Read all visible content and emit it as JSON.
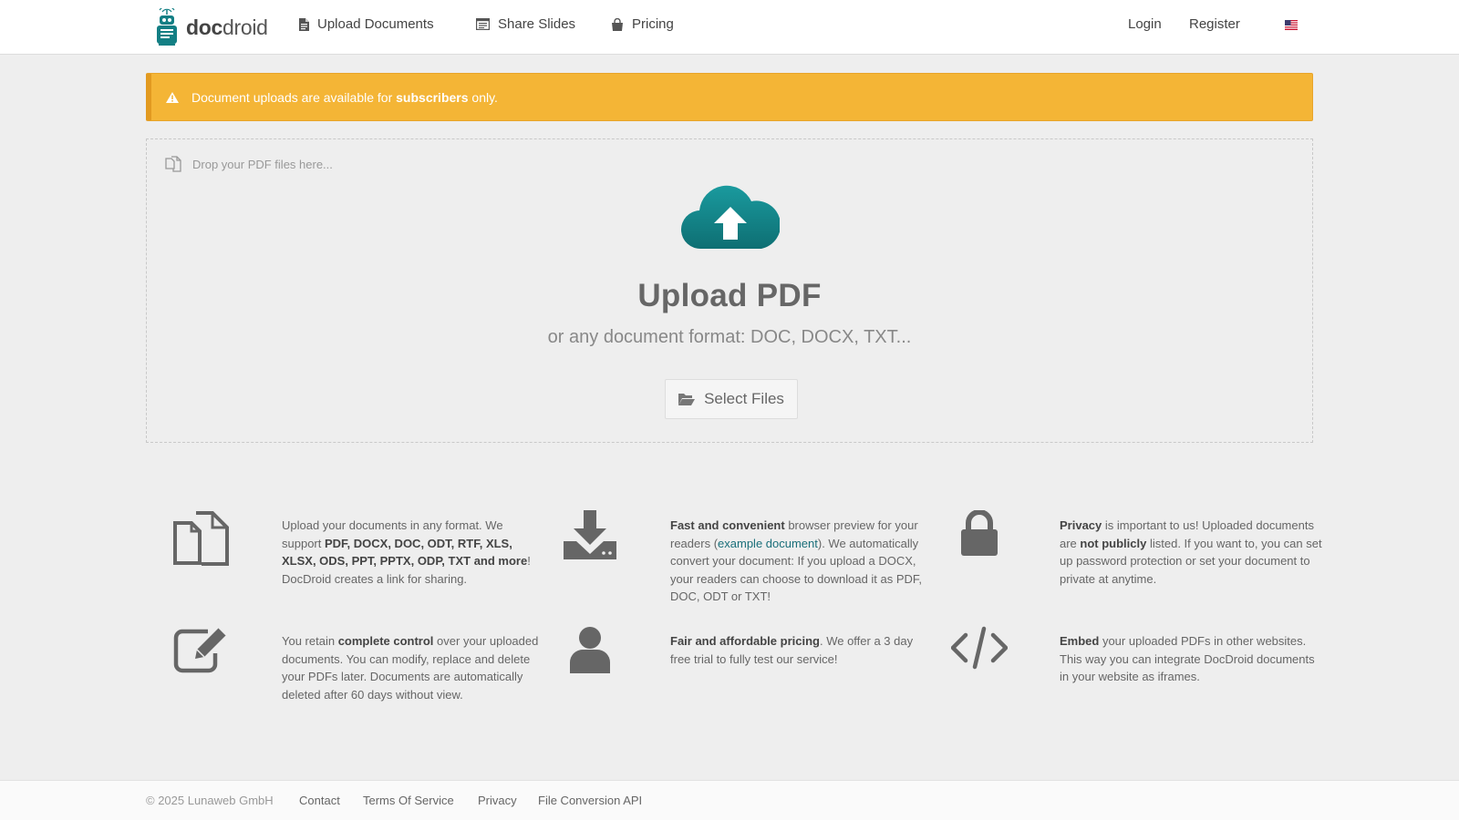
{
  "brand": {
    "logo_bold": "doc",
    "logo_light": "droid",
    "logo_icon": "robot-icon"
  },
  "nav": {
    "upload": {
      "label": "Upload Documents",
      "icon": "document-icon"
    },
    "share": {
      "label": "Share Slides",
      "icon": "slides-icon"
    },
    "pricing": {
      "label": "Pricing",
      "icon": "shopping-bag-icon"
    },
    "login": "Login",
    "register": "Register",
    "language_icon": "us-flag-icon"
  },
  "alert": {
    "icon": "warning-icon",
    "text_before": "Document uploads are available for ",
    "text_bold": "subscribers",
    "text_after": " only.",
    "color": "#f4b536"
  },
  "dropzone": {
    "hint": "Drop your PDF files here...",
    "title": "Upload PDF",
    "subtitle": "or any document format: DOC, DOCX, TXT...",
    "button": "Select Files",
    "cloud_color": "#137f84"
  },
  "features": [
    {
      "icon": "files-icon",
      "parts": [
        {
          "t": "Upload your documents in any format. We support "
        },
        {
          "t": "PDF, DOCX, DOC, ODT, RTF, XLS, XLSX, ODS, PPT, PPTX, ODP, TXT and more",
          "b": true
        },
        {
          "t": "! DocDroid creates a link for sharing."
        }
      ]
    },
    {
      "icon": "download-icon",
      "parts": [
        {
          "t": "Fast and convenient",
          "b": true
        },
        {
          "t": " browser preview for your readers ("
        },
        {
          "t": "example document",
          "a": true
        },
        {
          "t": "). We automatically convert your document: If you upload a DOCX, your readers can choose to download it as PDF, DOC, ODT or TXT!"
        }
      ]
    },
    {
      "icon": "lock-icon",
      "parts": [
        {
          "t": "Privacy",
          "b": true
        },
        {
          "t": " is important to us! Uploaded documents are "
        },
        {
          "t": "not publicly",
          "b": true
        },
        {
          "t": " listed. If you want to, you can set up password protection or set your document to private at anytime."
        }
      ]
    },
    {
      "icon": "edit-icon",
      "parts": [
        {
          "t": "You retain "
        },
        {
          "t": "complete control",
          "b": true
        },
        {
          "t": " over your uploaded documents. You can modify, replace and delete your PDFs later. Documents are automatically deleted after 60 days without view."
        }
      ]
    },
    {
      "icon": "user-icon",
      "parts": [
        {
          "t": "Fair and affordable pricing",
          "b": true
        },
        {
          "t": ". We offer a 3 day free trial to fully test our service!"
        }
      ]
    },
    {
      "icon": "code-icon",
      "parts": [
        {
          "t": "Embed",
          "b": true
        },
        {
          "t": " your uploaded PDFs in other websites. This way you can integrate DocDroid documents in your website as iframes."
        }
      ]
    }
  ],
  "footer": {
    "copyright": "© 2025 Lunaweb GmbH",
    "links": [
      "Contact",
      "Terms Of Service",
      "Privacy",
      "File Conversion API"
    ]
  }
}
